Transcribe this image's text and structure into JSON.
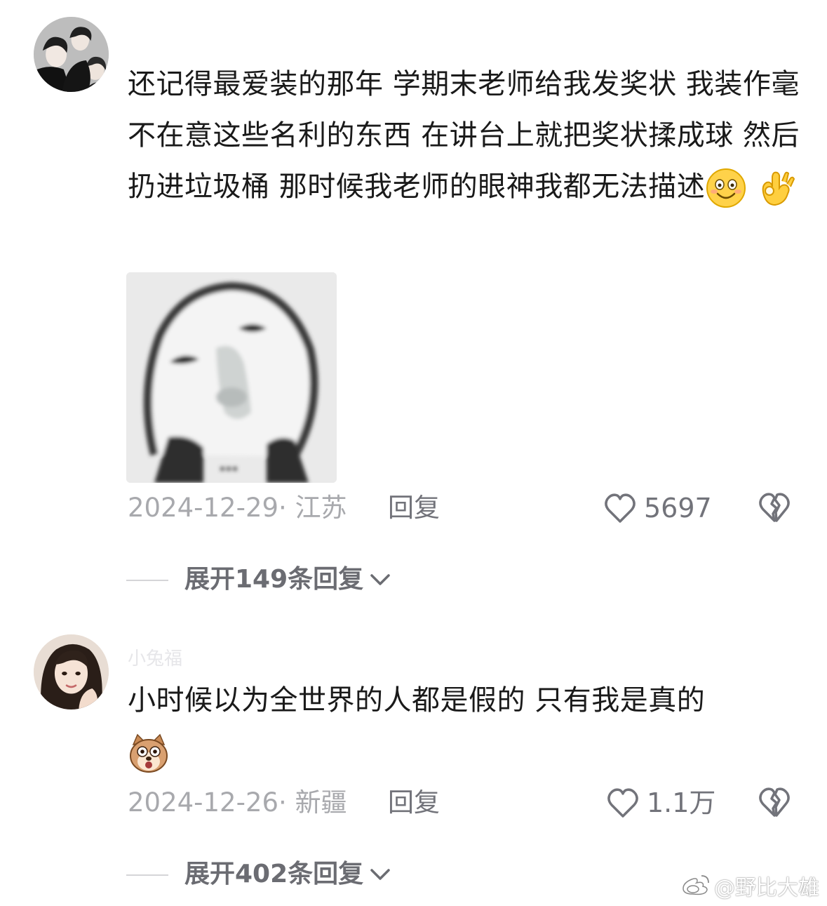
{
  "comments": [
    {
      "text": "还记得最爱装的那年 学期末老师给我发奖状 我装作毫不在意这些名利的东西 在讲台上就把奖状揉成球 然后扔进垃圾桶 那时候我老师的眼神我都无法描述",
      "emoji_names": [
        "grinning-face-emoji",
        "ok-hand-emoji"
      ],
      "date": "2024-12-29",
      "location": "江苏",
      "reply_label": "回复",
      "like_count": "5697",
      "expand_label": "展开149条回复"
    },
    {
      "username": "小兔福",
      "text": "小时候以为全世界的人都是假的 只有我是真的",
      "emoji_names": [
        "surprised-dog-emoji"
      ],
      "date": "2024-12-26",
      "location": "新疆",
      "reply_label": "回复",
      "like_count": "1.1万",
      "expand_label": "展开402条回复"
    }
  ],
  "watermark": {
    "text": "@野比大雄",
    "icon": "weibo-logo-icon"
  },
  "colors": {
    "text": "#1a1a1a",
    "meta": "#a8a9ad",
    "action": "#72737a"
  }
}
